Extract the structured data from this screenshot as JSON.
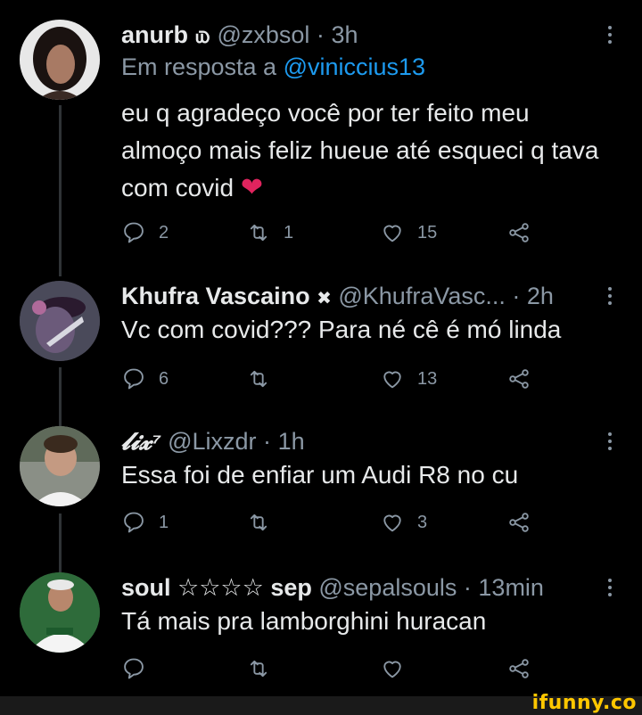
{
  "tweets": [
    {
      "name": "anurb ௰",
      "handle": "@zxbsol",
      "time": "3h",
      "reply_prefix": "Em resposta a",
      "reply_mention": "@viniccius13",
      "text": "eu q agradeço você por ter feito meu almoço mais feliz hueue até esqueci q tava com covid",
      "emoji": "❤",
      "replies": "2",
      "retweets": "1",
      "likes": "15"
    },
    {
      "name": "Khufra Vascaino",
      "badge": "✖",
      "handle": "@KhufraVasc...",
      "time": "2h",
      "text": "Vc com covid??? Para né cê é mó linda",
      "replies": "6",
      "retweets": "",
      "likes": "13"
    },
    {
      "name": "𝓵𝓲𝔁⁷",
      "handle": "@Lixzdr",
      "time": "1h",
      "text": "Essa foi de enfiar um Audi R8 no cu",
      "replies": "1",
      "retweets": "",
      "likes": "3"
    },
    {
      "name": "soul ☆☆☆☆ sep",
      "handle": "@sepalsouls",
      "time": "13min",
      "text": "Tá mais pra lamborghini huracan",
      "replies": "",
      "retweets": "",
      "likes": ""
    }
  ],
  "watermark": "ifunny.co",
  "colors": {
    "background": "#000000",
    "text": "#e7e9ea",
    "muted": "#8b98a5",
    "mention": "#1d9bf0",
    "heart": "#e0245e",
    "ifunny": "#ffc700"
  }
}
